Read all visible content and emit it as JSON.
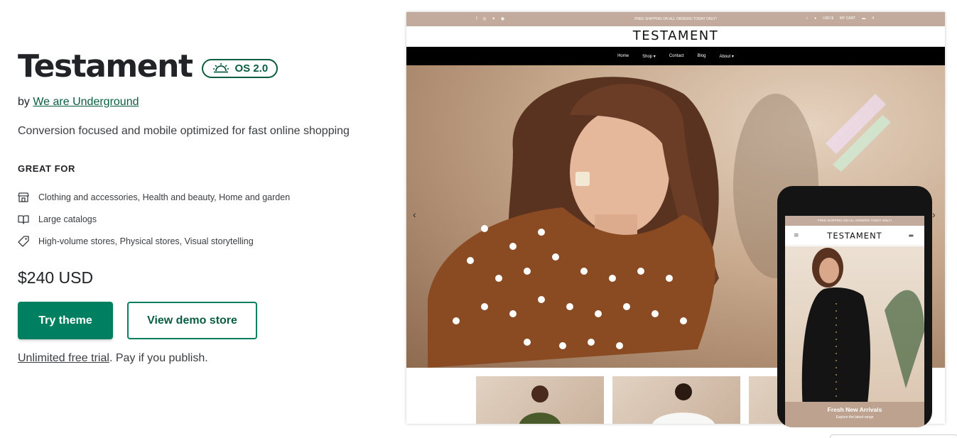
{
  "theme": {
    "name": "Testament",
    "badge": "OS 2.0",
    "by_prefix": "by",
    "developer": "We are Underground",
    "tagline": "Conversion focused and mobile optimized for fast online shopping",
    "great_for_heading": "GREAT FOR",
    "features": [
      {
        "icon": "store-icon",
        "text": "Clothing and accessories, Health and beauty, Home and garden"
      },
      {
        "icon": "book-icon",
        "text": "Large catalogs"
      },
      {
        "icon": "tag-icon",
        "text": "High-volume stores, Physical stores, Visual storytelling"
      }
    ],
    "price": "$240 USD",
    "try_button": "Try theme",
    "demo_button": "View demo store",
    "trial_link": "Unlimited free trial",
    "trial_suffix": ". Pay if you publish."
  },
  "preview": {
    "desktop": {
      "announcement": "FREE SHIPPING ON ALL ORDERS! TODAY ONLY!",
      "currency": "USD $",
      "cart": "MY CART",
      "cart_count": "4",
      "logo": "TESTAMENT",
      "nav": [
        "Home",
        "Shop",
        "Contact",
        "Blog",
        "About"
      ]
    },
    "mobile": {
      "announcement": "FREE SHIPPING ON ALL ORDERS! TODAY ONLY!",
      "logo": "TESTAMENT",
      "hero_heading": "Fresh New Arrivals",
      "hero_sub": "Explore the latest range"
    }
  },
  "colors": {
    "brand_green": "#008060",
    "badge_green": "#0a5d42",
    "announce_bar": "#c2aa9c"
  }
}
